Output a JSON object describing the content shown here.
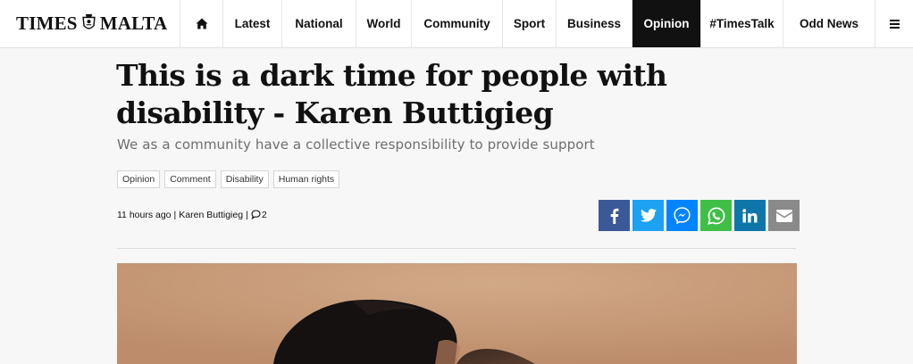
{
  "site": {
    "logo_left": "TIMES",
    "logo_right": "MALTA"
  },
  "nav": {
    "items": [
      {
        "label": "Latest",
        "active": false
      },
      {
        "label": "National",
        "active": false
      },
      {
        "label": "World",
        "active": false
      },
      {
        "label": "Community",
        "active": false
      },
      {
        "label": "Sport",
        "active": false
      },
      {
        "label": "Business",
        "active": false
      },
      {
        "label": "Opinion",
        "active": true
      },
      {
        "label": "#TimesTalk",
        "active": false
      },
      {
        "label": "Odd News",
        "active": false
      }
    ]
  },
  "article": {
    "title": "This is a dark time for people with disability - Karen Buttigieg",
    "subtitle": "We as a community have a collective responsibility to provide support",
    "tags": [
      "Opinion",
      "Comment",
      "Disability",
      "Human rights"
    ],
    "time": "11 hours ago",
    "author": "Karen Buttigieg",
    "comments": "2"
  },
  "share": [
    {
      "icon": "facebook-icon",
      "color": "#3b5998"
    },
    {
      "icon": "twitter-icon",
      "color": "#1da1f2"
    },
    {
      "icon": "messenger-icon",
      "color": "#0084ff"
    },
    {
      "icon": "whatsapp-icon",
      "color": "#3fbf46"
    },
    {
      "icon": "linkedin-icon",
      "color": "#0e76a8"
    },
    {
      "icon": "email-icon",
      "color": "#8a8a8a"
    }
  ]
}
